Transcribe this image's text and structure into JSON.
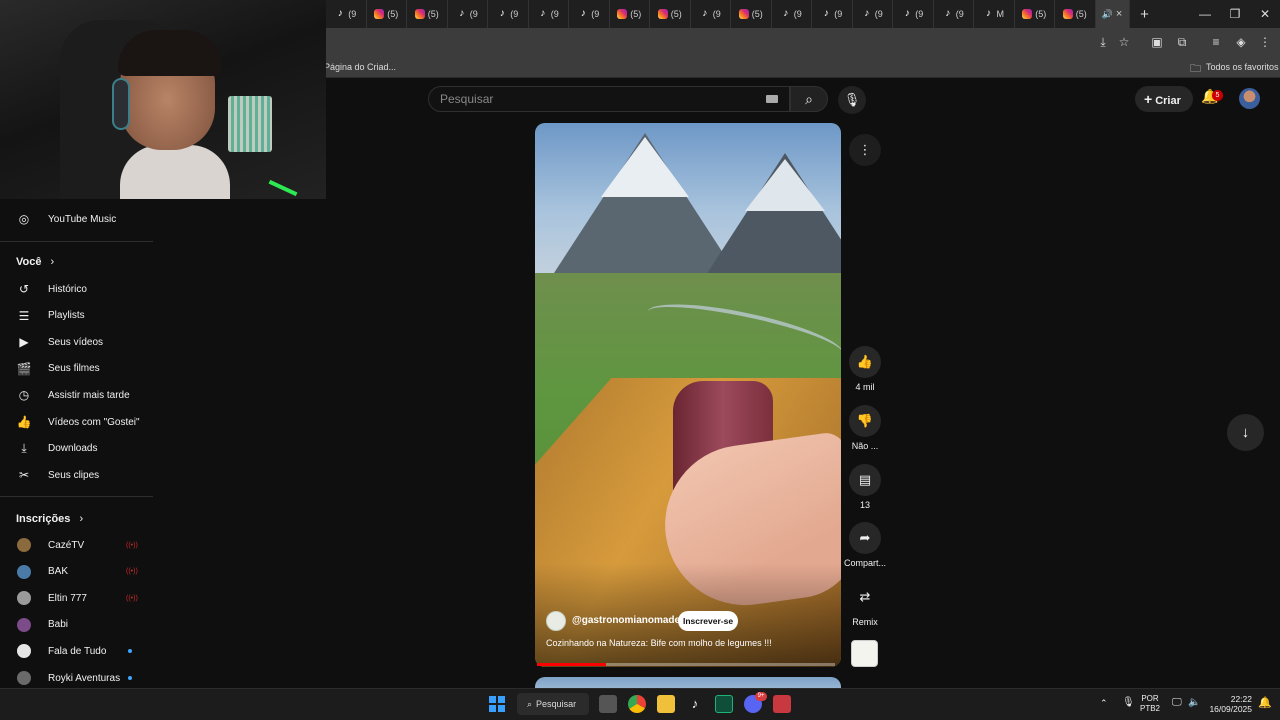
{
  "browser": {
    "tabs": [
      {
        "type": "tiktok",
        "label": "(9"
      },
      {
        "type": "instagram",
        "label": "(5)"
      },
      {
        "type": "instagram",
        "label": "(5)"
      },
      {
        "type": "tiktok",
        "label": "(9"
      },
      {
        "type": "tiktok",
        "label": "(9"
      },
      {
        "type": "tiktok",
        "label": "(9"
      },
      {
        "type": "tiktok",
        "label": "(9"
      },
      {
        "type": "instagram",
        "label": "(5)"
      },
      {
        "type": "instagram",
        "label": "(5)"
      },
      {
        "type": "tiktok",
        "label": "(9"
      },
      {
        "type": "instagram",
        "label": "(5)"
      },
      {
        "type": "tiktok",
        "label": "(9"
      },
      {
        "type": "tiktok",
        "label": "(9"
      },
      {
        "type": "tiktok",
        "label": "(9"
      },
      {
        "type": "tiktok",
        "label": "(9"
      },
      {
        "type": "tiktok",
        "label": "(9"
      },
      {
        "type": "tiktok",
        "label": "M"
      },
      {
        "type": "instagram",
        "label": "(5)"
      },
      {
        "type": "instagram",
        "label": "(5)"
      }
    ],
    "active_tab_close": "×",
    "new_tab": "+",
    "bookmarks": {
      "item": "Página do Criad...",
      "all_bookmarks": "Todos os favoritos"
    }
  },
  "youtube": {
    "search_placeholder": "Pesquisar",
    "create_label": "Criar",
    "notification_count": "5",
    "sidebar": {
      "music": "YouTube Music",
      "you_heading": "Você",
      "you_items": [
        {
          "label": "Histórico",
          "icon": "history-icon",
          "glyph": "↺"
        },
        {
          "label": "Playlists",
          "icon": "playlist-icon",
          "glyph": "☰"
        },
        {
          "label": "Seus vídeos",
          "icon": "your-videos-icon",
          "glyph": "▶"
        },
        {
          "label": "Seus filmes",
          "icon": "movies-icon",
          "glyph": "🎬"
        },
        {
          "label": "Assistir mais tarde",
          "icon": "watch-later-icon",
          "glyph": "◷"
        },
        {
          "label": "Vídeos com \"Gostei\"",
          "icon": "liked-icon",
          "glyph": "👍"
        },
        {
          "label": "Downloads",
          "icon": "download-icon",
          "glyph": "⤓"
        },
        {
          "label": "Seus clipes",
          "icon": "clips-icon",
          "glyph": "✂"
        }
      ],
      "subs_heading": "Inscrições",
      "subscriptions": [
        {
          "name": "CazéTV",
          "status": "live",
          "color": "#8b6b3d"
        },
        {
          "name": "BAK",
          "status": "live",
          "color": "#4a7ba6"
        },
        {
          "name": "Eltin 777",
          "status": "live",
          "color": "#9a9a9a"
        },
        {
          "name": "Babi",
          "status": "none",
          "color": "#7b4b8a"
        },
        {
          "name": "Fala de Tudo",
          "status": "new",
          "color": "#e5e5e5"
        },
        {
          "name": "Royki Aventuras",
          "status": "new",
          "color": "#6a6a6a"
        }
      ]
    },
    "short": {
      "channel": "@gastronomianomades",
      "subscribe_label": "Inscrever-se",
      "title": "Cozinhando na Natureza: Bife com molho de legumes !!!",
      "progress": 0.23,
      "actions": {
        "like_count": "4 mil",
        "dislike_label": "Não ...",
        "comment_count": "13",
        "share_label": "Compart...",
        "remix_label": "Remix"
      }
    }
  },
  "taskbar": {
    "search_label": "Pesquisar",
    "lang_line1": "POR",
    "lang_line2": "PTB2",
    "time": "22:22",
    "date": "16/09/2025",
    "discord_badge": "9+"
  }
}
